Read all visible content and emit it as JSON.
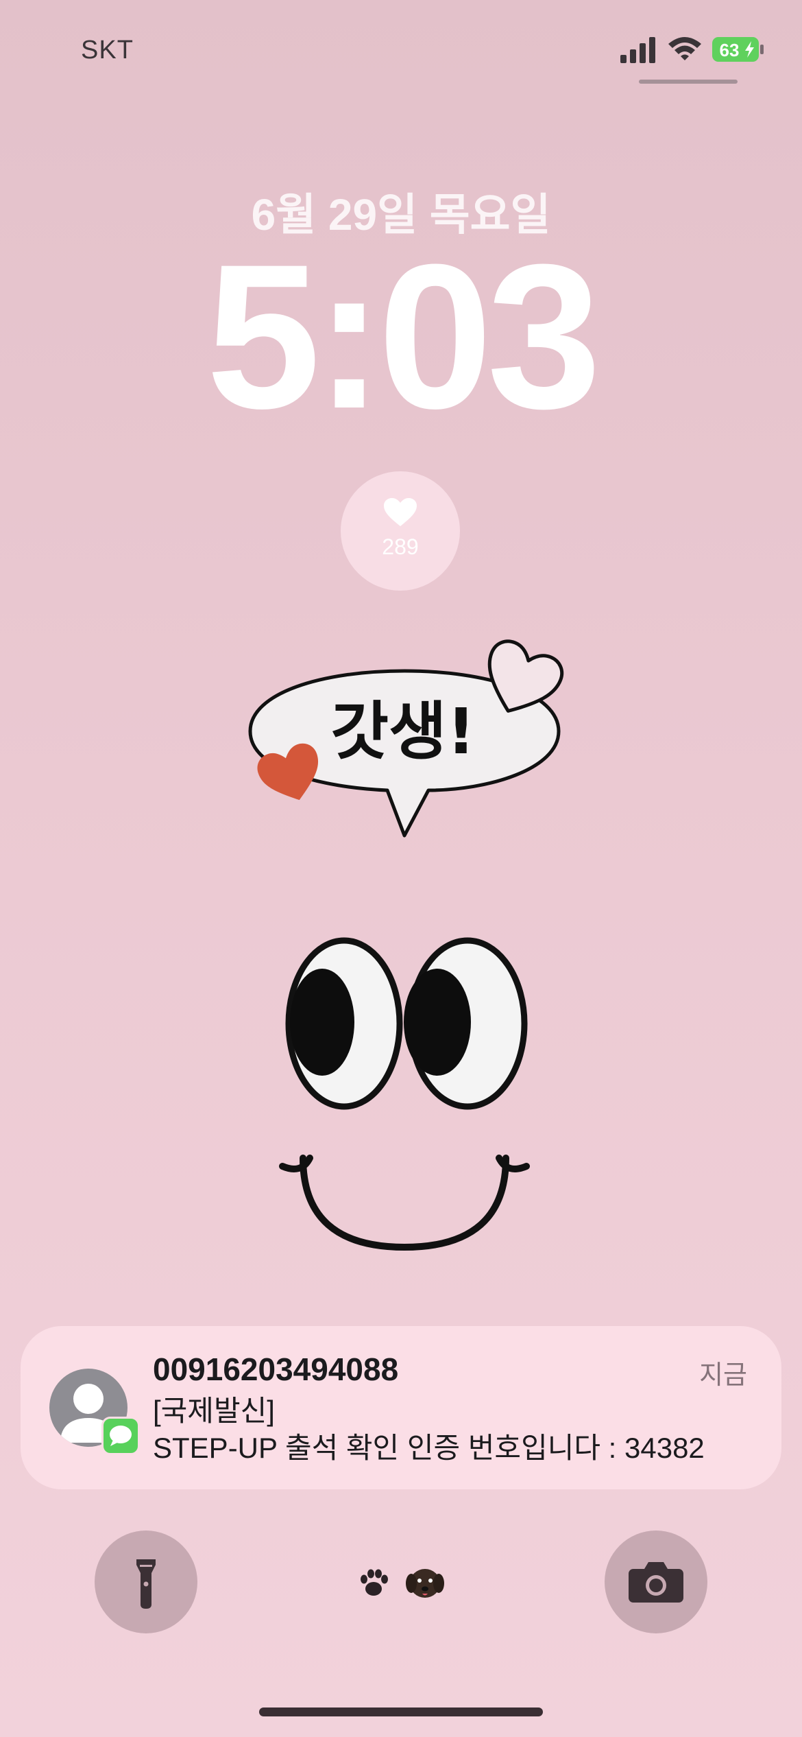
{
  "status_bar": {
    "carrier": "SKT",
    "signal_icon": "cellular-signal-icon",
    "wifi_icon": "wifi-icon",
    "battery_percent": "63",
    "battery_charging": true,
    "battery_color": "#5fd15d"
  },
  "lock_screen": {
    "date": "6월 29일 목요일",
    "time": "5:03"
  },
  "widget": {
    "icon": "heart-icon",
    "value": "289"
  },
  "wallpaper": {
    "speech_bubble_text": "갓생!"
  },
  "notification": {
    "app_icon": "messages-icon",
    "sender": "00916203494088",
    "time": "지금",
    "line1": "[국제발신]",
    "line2": "STEP-UP 출석 확인 인증 번호입니다 : 34382"
  },
  "bottom_bar": {
    "left_button_icon": "flashlight-icon",
    "right_button_icon": "camera-icon",
    "center_emojis": "🐾 🐶"
  },
  "colors": {
    "background_top": "#e3c1ca",
    "background_bottom": "#f2d2db",
    "notification_bg": "#fbdee6",
    "heart_red": "#d4573a"
  }
}
